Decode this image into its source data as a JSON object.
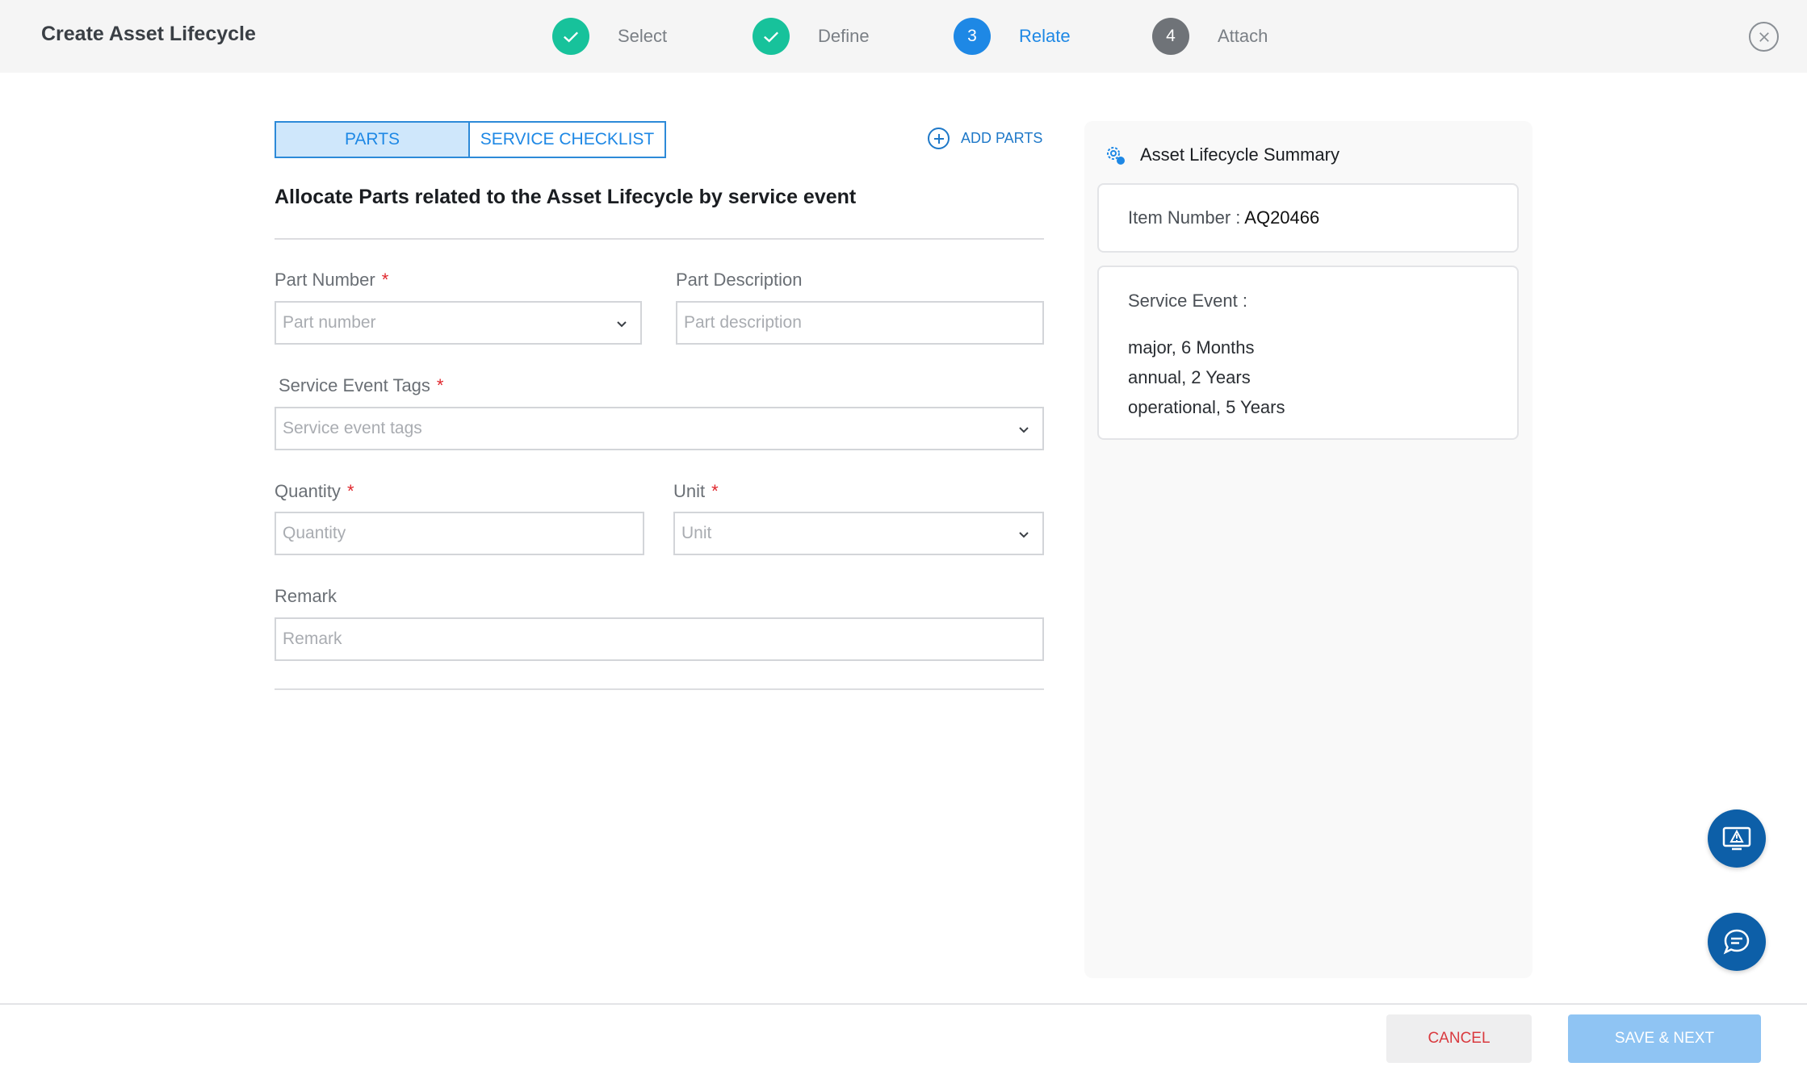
{
  "header": {
    "title": "Create Asset Lifecycle",
    "steps": [
      {
        "label": "Select",
        "number": "",
        "state": "done"
      },
      {
        "label": "Define",
        "number": "",
        "state": "done"
      },
      {
        "label": "Relate",
        "number": "3",
        "state": "active"
      },
      {
        "label": "Attach",
        "number": "4",
        "state": "pending"
      }
    ],
    "close_icon": "close-icon"
  },
  "tabs": {
    "parts": "PARTS",
    "service_checklist": "SERVICE CHECKLIST"
  },
  "add_parts_label": "ADD PARTS",
  "section_title": "Allocate Parts related to the Asset Lifecycle by service event",
  "form": {
    "part_number": {
      "label": "Part Number",
      "required": "*",
      "placeholder": "Part number"
    },
    "part_description": {
      "label": "Part Description",
      "placeholder": "Part description"
    },
    "service_event_tags": {
      "label": "Service Event Tags",
      "required": "*",
      "placeholder": "Service event tags"
    },
    "quantity": {
      "label": "Quantity",
      "required": "*",
      "placeholder": "Quantity"
    },
    "unit": {
      "label": "Unit",
      "required": "*",
      "placeholder": "Unit"
    },
    "remark": {
      "label": "Remark",
      "placeholder": "Remark"
    }
  },
  "summary": {
    "title": "Asset Lifecycle Summary",
    "item_number_label": "Item Number :",
    "item_number_value": "AQ20466",
    "service_event_label": "Service Event :",
    "service_events": [
      "major, 6 Months",
      "annual, 2 Years",
      "operational, 5 Years"
    ]
  },
  "footer": {
    "cancel": "CANCEL",
    "save_next": "SAVE & NEXT"
  },
  "colors": {
    "accent": "#1e88e5",
    "done": "#17c29b",
    "required": "#e0262c",
    "fab": "#0d5fa8"
  }
}
